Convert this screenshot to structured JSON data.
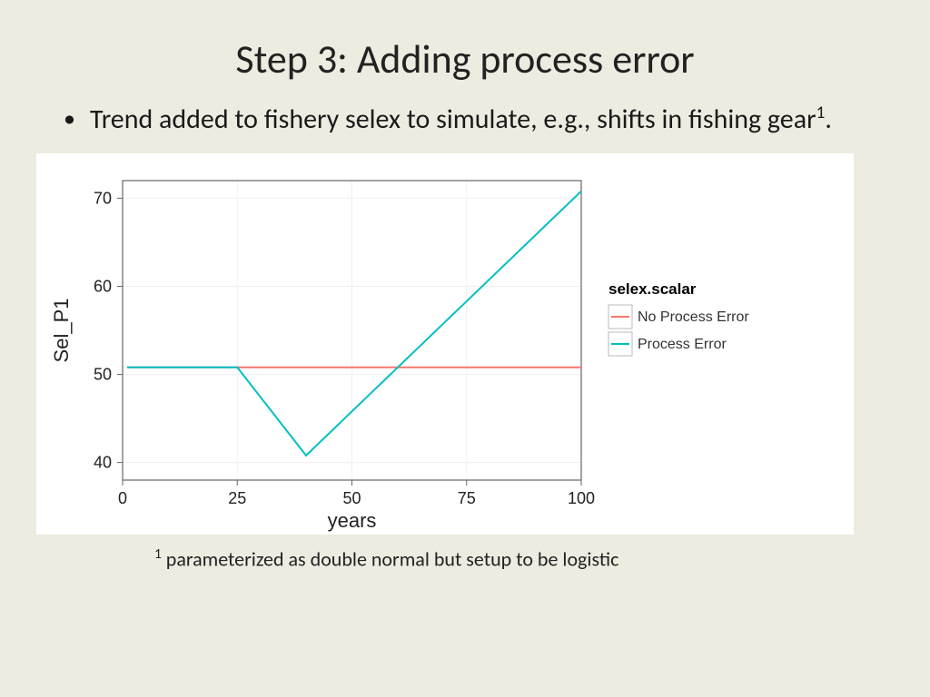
{
  "title": "Step 3: Adding process error",
  "bullet": {
    "text_pre": "Trend added to fishery selex to simulate, e.g., shifts in fishing gear",
    "sup": "1",
    "text_post": "."
  },
  "footnote": {
    "sup": "1",
    "text": " parameterized as double normal but setup to be logistic"
  },
  "chart_data": {
    "type": "line",
    "xlabel": "years",
    "ylabel": "Sel_P1",
    "legend_title": "selex.scalar",
    "xlim": [
      0,
      100
    ],
    "ylim": [
      38,
      72
    ],
    "x_ticks": [
      0,
      25,
      50,
      75,
      100
    ],
    "y_ticks": [
      40,
      50,
      60,
      70
    ],
    "series": [
      {
        "name": "No Process Error",
        "color": "#f8766d",
        "x": [
          1,
          100
        ],
        "y": [
          50.8,
          50.8
        ]
      },
      {
        "name": "Process Error",
        "color": "#00bfc4",
        "x": [
          1,
          25,
          40,
          100
        ],
        "y": [
          50.8,
          50.8,
          40.8,
          70.8
        ]
      }
    ]
  }
}
